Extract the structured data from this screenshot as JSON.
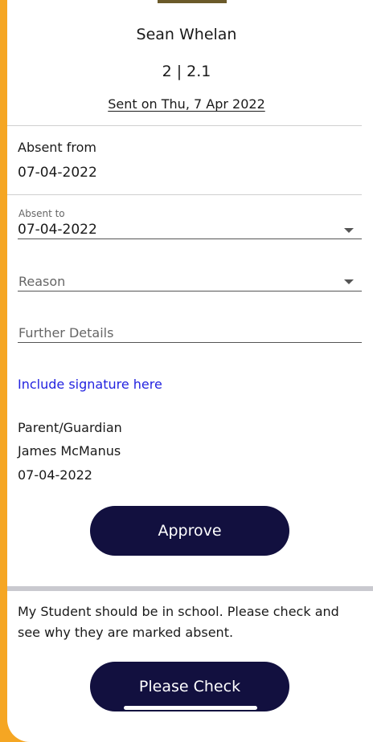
{
  "header": {
    "student_name": "Sean Whelan",
    "class": "2 | 2.1",
    "sent": "Sent on Thu, 7 Apr 2022"
  },
  "absent_from": {
    "label": "Absent from",
    "value": "07-04-2022"
  },
  "absent_to": {
    "label": "Absent to",
    "value": "07-04-2022"
  },
  "reason": {
    "placeholder": "Reason",
    "value": ""
  },
  "further_details": {
    "placeholder": "Further Details",
    "value": ""
  },
  "signature_link": "Include signature here",
  "parent": {
    "label": "Parent/Guardian",
    "name": "James McManus",
    "date": "07-04-2022"
  },
  "approve_button": "Approve",
  "message": "My Student should be in school. Please check and see why they are marked absent.",
  "please_check_button": "Please Check",
  "colors": {
    "background_accent": "#f5a623",
    "button": "#12103f",
    "link": "#2323e0"
  }
}
